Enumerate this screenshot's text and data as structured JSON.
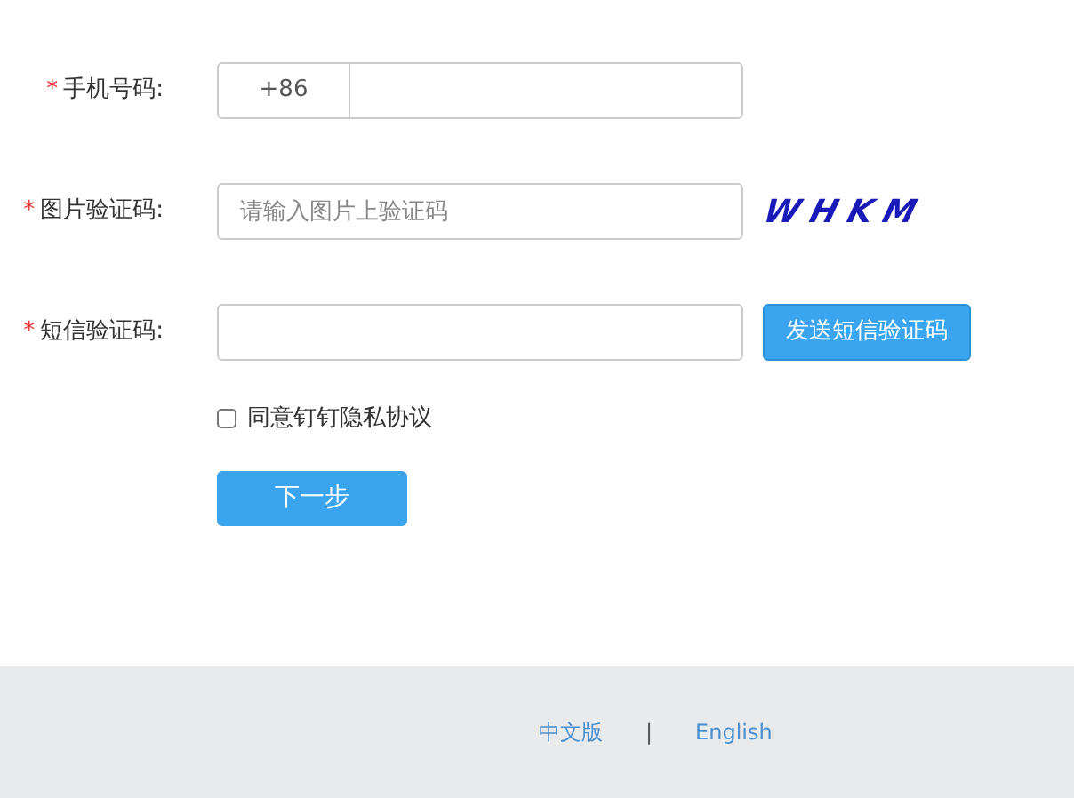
{
  "form": {
    "rows": [
      {
        "kind": "phone",
        "required_mark": "*",
        "label": "手机号码:",
        "prefix": "+86"
      },
      {
        "kind": "captcha",
        "required_mark": "*",
        "label": "图片验证码:",
        "placeholder": "请输入图片上验证码",
        "captcha": "WHKM"
      },
      {
        "kind": "sms",
        "required_mark": "*",
        "label": "短信验证码:",
        "button": "发送短信验证码"
      }
    ],
    "agreement": {
      "label": "同意钉钉隐私协议",
      "checked": false
    },
    "next_button": "下一步"
  },
  "footer": {
    "links": [
      "中文版",
      "English"
    ],
    "separator": "|"
  }
}
